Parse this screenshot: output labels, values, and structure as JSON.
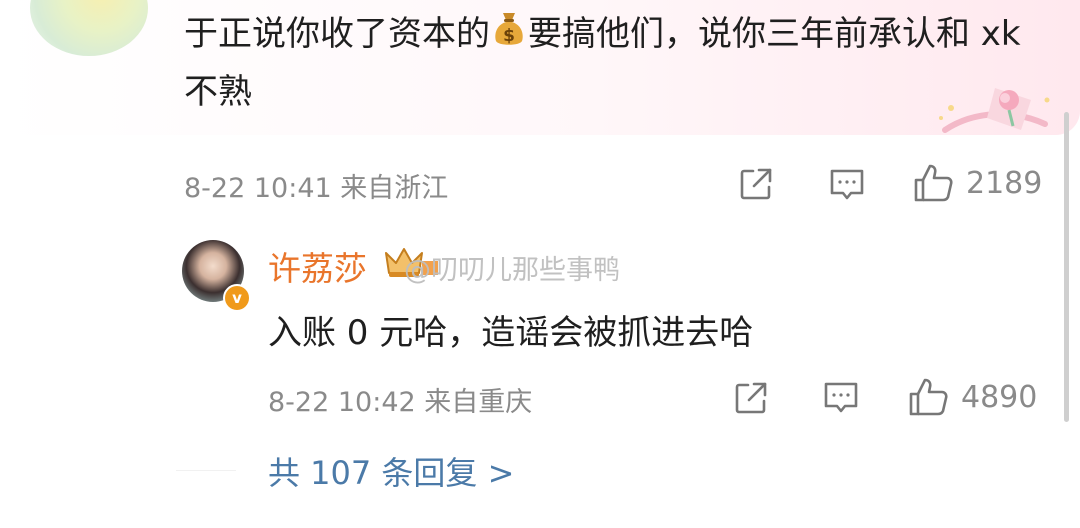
{
  "comment": {
    "text_part1": "于正说你收了资本的",
    "text_part2": "要搞他们，说你三年前承认和 xk 不熟",
    "emoji_icon": "money-bag-icon",
    "date": "8-22 10:41",
    "location": "来自浙江",
    "like_count": "2189"
  },
  "reply": {
    "user_name": "许荔莎",
    "watermark": "@叨叨儿那些事鸭",
    "text": "入账 0 元哈，造谣会被抓进去哈",
    "date": "8-22 10:42",
    "location": "来自重庆",
    "like_count": "4890"
  },
  "more_replies": "共 107 条回复 >",
  "colors": {
    "username": "#e9752b",
    "link": "#4b7aa8",
    "meta": "#8a8a8a",
    "verified_badge": "#f09a1b"
  }
}
